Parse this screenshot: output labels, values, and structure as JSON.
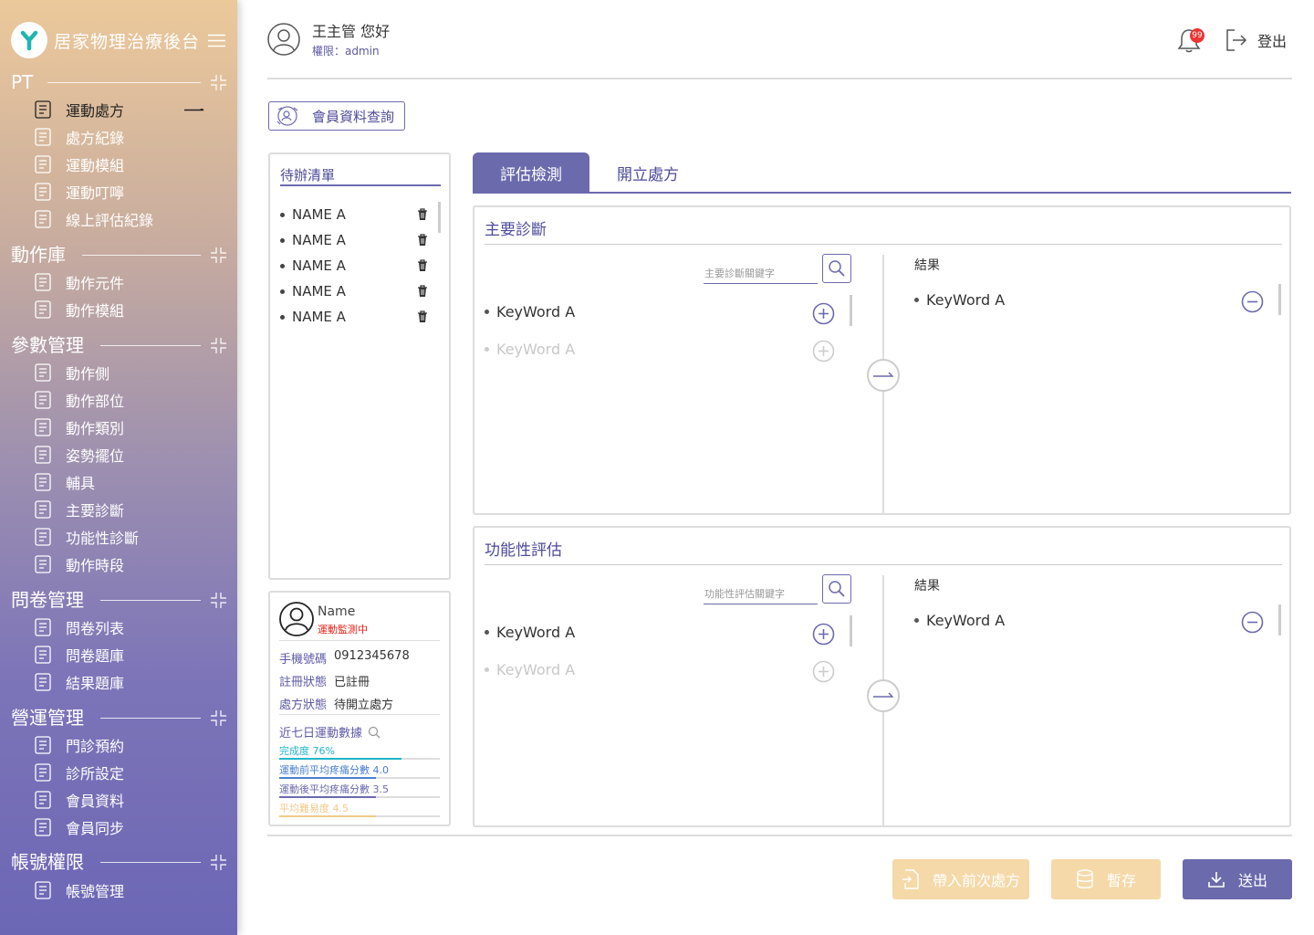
{
  "brand": {
    "title": "居家物理治療後台"
  },
  "sidebar": {
    "sections": [
      {
        "label": "PT",
        "items": [
          "運動處方",
          "處方紀錄",
          "運動模組",
          "運動叮嚀",
          "線上評估紀錄"
        ]
      },
      {
        "label": "動作庫",
        "items": [
          "動作元件",
          "動作模組"
        ]
      },
      {
        "label": "參數管理",
        "items": [
          "動作側",
          "動作部位",
          "動作類別",
          "姿勢擺位",
          "輔具",
          "主要診斷",
          "功能性診斷",
          "動作時段"
        ]
      },
      {
        "label": "問卷管理",
        "items": [
          "問卷列表",
          "問卷題庫",
          "結果題庫"
        ]
      },
      {
        "label": "營運管理",
        "items": [
          "門診預約",
          "診所設定",
          "會員資料",
          "會員同步"
        ]
      },
      {
        "label": "帳號權限",
        "items": [
          "帳號管理"
        ]
      }
    ],
    "active_item": "運動處方"
  },
  "header": {
    "greeting": "王主管 您好",
    "role": "權限：admin",
    "notification_count": "99",
    "logout_label": "登出"
  },
  "member_query_label": "會員資料查詢",
  "todo": {
    "title": "待辦清單",
    "items": [
      "NAME A",
      "NAME A",
      "NAME A",
      "NAME A",
      "NAME A"
    ]
  },
  "member_card": {
    "name": "Name",
    "status": "運動監測中",
    "phone_label": "手機號碼",
    "phone": "0912345678",
    "reg_label": "註冊狀態",
    "reg": "已註冊",
    "rx_label": "處方狀態",
    "rx": "待開立處方",
    "stats_title": "近七日運動數據",
    "bars": [
      {
        "label": "完成度 76%",
        "value": 0.76,
        "color": "#1fb5c9"
      },
      {
        "label": "運動前平均疼痛分數 4.0",
        "value": 0.6,
        "color": "#4a7fd1"
      },
      {
        "label": "運動後平均疼痛分數 3.5",
        "value": 0.6,
        "color": "#6b6aad"
      },
      {
        "label": "平均難易度 4.5",
        "value": 0.6,
        "color": "#f0c98a"
      }
    ]
  },
  "tabs": {
    "active": "評估檢測",
    "other": "開立處方"
  },
  "panels": [
    {
      "title": "主要診斷",
      "search_placeholder": "主要診斷關鍵字",
      "keywords": [
        "KeyWord A",
        "KeyWord A"
      ],
      "result_title": "結果",
      "results": [
        "KeyWord A"
      ]
    },
    {
      "title": "功能性評估",
      "search_placeholder": "功能性評估關鍵字",
      "keywords": [
        "KeyWord A",
        "KeyWord A"
      ],
      "result_title": "結果",
      "results": [
        "KeyWord A"
      ]
    }
  ],
  "footer": {
    "load_prev_label": "帶入前次處方",
    "save_label": "暫存",
    "submit_label": "送出",
    "colors": {
      "load": "#f5d9a8",
      "save": "#f5d9a8",
      "submit": "#6b6aad"
    }
  }
}
